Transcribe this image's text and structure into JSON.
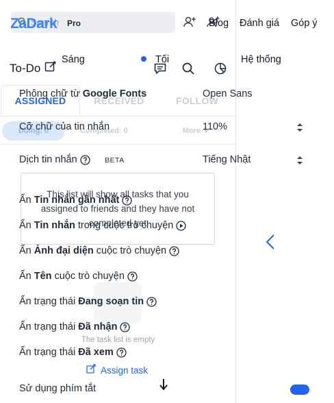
{
  "todo_panel": {
    "search_placeholder": "Search",
    "header_title": "To-Do",
    "tabs": [
      {
        "label": "ASSIGNED",
        "active": true
      },
      {
        "label": "RECEIVED",
        "active": false
      },
      {
        "label": "FOLLOW",
        "active": false
      }
    ],
    "filters": {
      "doing": "Doing: 0",
      "completed": "Completed: 0",
      "more": "More"
    },
    "empty_note": "This list will show all tasks that you assigned to friends and they have not completed yet",
    "empty_text": "The task list is empty",
    "assign_task": "Assign task"
  },
  "zadark": {
    "logo": "ZaDark",
    "badge": "Pro",
    "nav": {
      "blog": "Blog",
      "rate": "Đánh giá",
      "feedback": "Góp ý"
    },
    "theme": {
      "light": "Sáng",
      "dark": "Tối",
      "system": "Hệ thống",
      "selected": "Tối"
    },
    "settings": {
      "font_prefix": "Phông chữ từ",
      "font_bold": "Google Fonts",
      "font_value": "Open Sans",
      "font_size_label": "Cỡ chữ của tin nhắn",
      "font_size_value": "110%",
      "translate_label": "Dịch tin nhắn",
      "translate_badge": "BETA",
      "translate_value": "Tiếng Nhật",
      "hide_latest_prefix": "Ẩn",
      "hide_latest_bold": "Tin nhắn gần nhất",
      "hide_msgs_prefix": "Ẩn",
      "hide_msgs_bold": "Tin nhắn",
      "hide_msgs_suffix": "trong cuộc trò chuyện",
      "hide_avatar_prefix": "Ẩn",
      "hide_avatar_bold": "Ảnh đại diện",
      "hide_avatar_suffix": "cuộc trò chuyện",
      "hide_name_prefix": "Ẩn",
      "hide_name_bold": "Tên",
      "hide_name_suffix": "cuộc trò chuyện",
      "typing_prefix": "Ẩn trạng thái",
      "typing_bold": "Đang soạn tin",
      "received_prefix": "Ẩn trạng thái",
      "received_bold": "Đã nhận",
      "seen_prefix": "Ẩn trạng thái",
      "seen_bold": "Đã xem",
      "shortcuts_label": "Sử dụng phím tắt",
      "shortcuts_enabled": true
    }
  },
  "colors": {
    "accent": "#2563eb",
    "logo": "#3b82f6",
    "chip_bg": "#dbe7fb"
  },
  "icons": [
    "search-icon",
    "add-friend-icon",
    "create-group-icon",
    "edit-icon",
    "message-icon",
    "search-icon",
    "pie-chart-icon",
    "help-icon",
    "updown-icon",
    "chevron-left-icon",
    "play-circle-icon",
    "arrow-down-icon",
    "caret-down-icon"
  ]
}
